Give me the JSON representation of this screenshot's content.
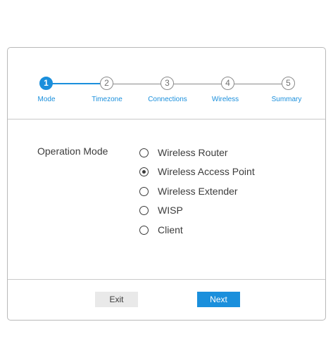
{
  "steps": [
    {
      "number": "1",
      "label": "Mode",
      "active": true
    },
    {
      "number": "2",
      "label": "Timezone",
      "active": false
    },
    {
      "number": "3",
      "label": "Connections",
      "active": false
    },
    {
      "number": "4",
      "label": "Wireless",
      "active": false
    },
    {
      "number": "5",
      "label": "Summary",
      "active": false
    }
  ],
  "operation_mode": {
    "label": "Operation Mode",
    "options": [
      {
        "label": "Wireless Router",
        "selected": false
      },
      {
        "label": "Wireless Access Point",
        "selected": true
      },
      {
        "label": "Wireless Extender",
        "selected": false
      },
      {
        "label": "WISP",
        "selected": false
      },
      {
        "label": "Client",
        "selected": false
      }
    ]
  },
  "buttons": {
    "exit_label": "Exit",
    "next_label": "Next"
  },
  "colors": {
    "accent": "#1a8fdc",
    "border": "#b9b9b9"
  }
}
